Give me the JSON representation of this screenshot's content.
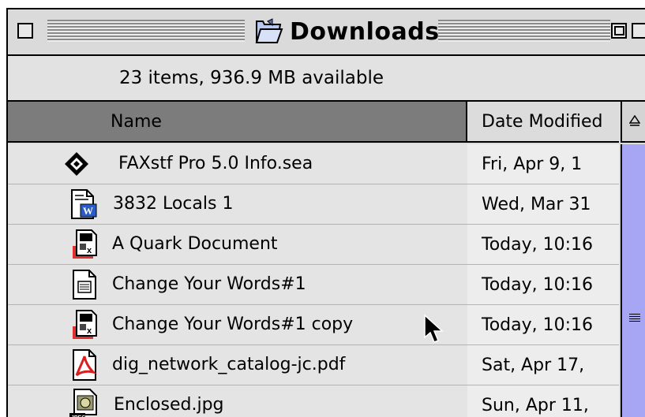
{
  "window": {
    "title": "Downloads",
    "info": "23 items, 936.9 MB available"
  },
  "columns": {
    "name": "Name",
    "date": "Date Modified"
  },
  "files": [
    {
      "name": "FAXstf Pro 5.0 Info.sea",
      "date": "Fri, Apr 9, 1",
      "icon": "faxstf-archive-icon"
    },
    {
      "name": "3832 Locals 1",
      "date": "Wed, Mar 31",
      "icon": "word-document-icon"
    },
    {
      "name": "A Quark Document",
      "date": "Today, 10:16",
      "icon": "quark-document-icon"
    },
    {
      "name": "Change Your Words#1",
      "date": "Today, 10:16",
      "icon": "text-document-icon"
    },
    {
      "name": "Change Your Words#1 copy",
      "date": "Today, 10:16",
      "icon": "quark-document-icon"
    },
    {
      "name": "dig_network_catalog-jc.pdf",
      "date": "Sat, Apr 17,",
      "icon": "pdf-document-icon"
    },
    {
      "name": "Enclosed.jpg",
      "date": "Sun, Apr 11,",
      "icon": "jpeg-image-icon"
    }
  ],
  "colors": {
    "scrollbar_track": "#a6a6f4",
    "sorted_column_header": "#7c7c7c"
  }
}
